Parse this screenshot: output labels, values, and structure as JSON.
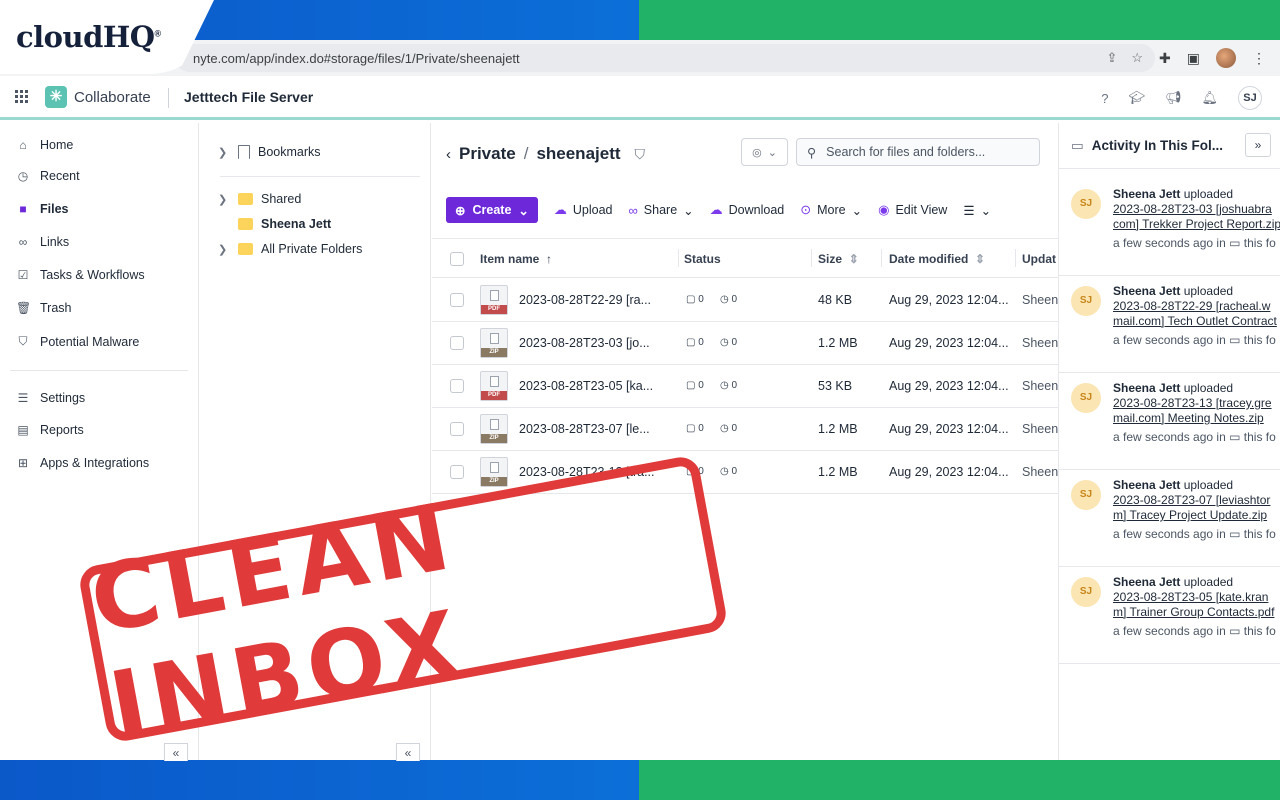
{
  "branding": {
    "logo_text": "cloudHQ",
    "logo_mark": "®"
  },
  "browser": {
    "url": "nyte.com/app/index.do#storage/files/1/Private/sheenajett"
  },
  "appbar": {
    "brand": "Collaborate",
    "server": "Jetttech File Server",
    "user_initials": "SJ"
  },
  "nav": {
    "items": [
      {
        "label": "Home"
      },
      {
        "label": "Recent"
      },
      {
        "label": "Files"
      },
      {
        "label": "Links"
      },
      {
        "label": "Tasks & Workflows"
      },
      {
        "label": "Trash"
      },
      {
        "label": "Potential Malware"
      },
      {
        "label": "Settings"
      },
      {
        "label": "Reports"
      },
      {
        "label": "Apps & Integrations"
      }
    ],
    "collapse_icon": "«"
  },
  "folders": {
    "bookmarks": "Bookmarks",
    "shared": "Shared",
    "sheena": "Sheena Jett",
    "all_private": "All Private Folders"
  },
  "main": {
    "crumb_root": "Private",
    "crumb_sep": "/",
    "crumb_current": "sheenajett",
    "search_placeholder": "Search for files and folders...",
    "toolbar": {
      "create": "Create",
      "upload": "Upload",
      "share": "Share",
      "download": "Download",
      "more": "More",
      "edit_view": "Edit View"
    },
    "columns": {
      "item_name": "Item name",
      "status": "Status",
      "size": "Size",
      "date_modified": "Date modified",
      "updated": "Updat"
    },
    "rows": [
      {
        "name": "2023-08-28T22-29 [ra...",
        "type": "PDF",
        "comments": "0",
        "versions": "0",
        "size": "48 KB",
        "date": "Aug 29, 2023 12:04...",
        "updated_by": "Sheen"
      },
      {
        "name": "2023-08-28T23-03 [jo...",
        "type": "ZIP",
        "comments": "0",
        "versions": "0",
        "size": "1.2 MB",
        "date": "Aug 29, 2023 12:04...",
        "updated_by": "Sheen"
      },
      {
        "name": "2023-08-28T23-05 [ka...",
        "type": "PDF",
        "comments": "0",
        "versions": "0",
        "size": "53 KB",
        "date": "Aug 29, 2023 12:04...",
        "updated_by": "Sheen"
      },
      {
        "name": "2023-08-28T23-07 [le...",
        "type": "ZIP",
        "comments": "0",
        "versions": "0",
        "size": "1.2 MB",
        "date": "Aug 29, 2023 12:04...",
        "updated_by": "Sheen"
      },
      {
        "name": "2023-08-28T23-13 [tra...",
        "type": "ZIP",
        "comments": "0",
        "versions": "0",
        "size": "1.2 MB",
        "date": "Aug 29, 2023 12:04...",
        "updated_by": "Sheen"
      }
    ]
  },
  "activity": {
    "title": "Activity In This Fol...",
    "expand_icon": "»",
    "items": [
      {
        "initials": "SJ",
        "user": "Sheena Jett",
        "action": "uploaded",
        "link1": "2023-08-28T23-03 [joshuabra",
        "link2": "com] Trekker Project Report.zip",
        "time": "a few seconds ago in",
        "where": "this fo"
      },
      {
        "initials": "SJ",
        "user": "Sheena Jett",
        "action": "uploaded",
        "link1": "2023-08-28T22-29 [racheal.w",
        "link2": "mail.com] Tech Outlet Contract",
        "time": "a few seconds ago in",
        "where": "this fo"
      },
      {
        "initials": "SJ",
        "user": "Sheena Jett",
        "action": "uploaded",
        "link1": "2023-08-28T23-13 [tracey.gre",
        "link2": "mail.com] Meeting Notes.zip",
        "time": "a few seconds ago in",
        "where": "this fo"
      },
      {
        "initials": "SJ",
        "user": "Sheena Jett",
        "action": "uploaded",
        "link1": "2023-08-28T23-07 [leviashtor",
        "link2": "m] Tracey Project Update.zip",
        "time": "a few seconds ago in",
        "where": "this fo"
      },
      {
        "initials": "SJ",
        "user": "Sheena Jett",
        "action": "uploaded",
        "link1": "2023-08-28T23-05 [kate.kran",
        "link2": "m] Trainer Group Contacts.pdf",
        "time": "a few seconds ago in",
        "where": "this fo"
      }
    ]
  },
  "stamp": {
    "text": "CLEAN INBOX"
  },
  "colors": {
    "accent": "#6d28d9",
    "stamp": "#e03a3a",
    "band_blue": "#0b58c9",
    "band_green": "#21b167",
    "brand_teal": "#5cc3b3"
  }
}
